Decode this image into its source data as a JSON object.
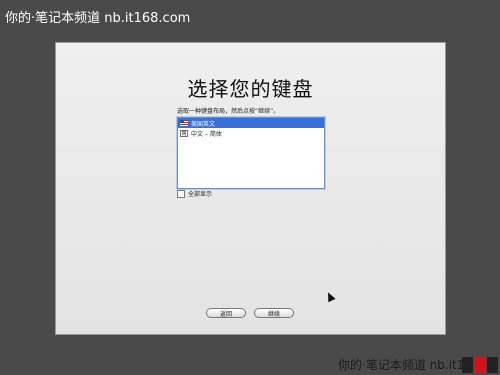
{
  "watermark": {
    "top": "你的·笔记本频道  nb.it168.com",
    "bottom": "你的·笔记本频道  nb.it1"
  },
  "installer": {
    "title": "选择您的键盘",
    "instruction": "选取一种键盘布局，然后点按“继续”。",
    "layouts": [
      {
        "label": "美国英文",
        "icon": "us-flag-icon",
        "selected": true
      },
      {
        "label": "中文 – 简体",
        "icon": "chinese-input-icon",
        "selected": false
      }
    ],
    "show_all_label": "全部显示",
    "buttons": {
      "back": "返回",
      "continue": "继续"
    }
  },
  "colors": {
    "background": "#4a4a4a",
    "selection": "#3a6fd8",
    "logo_red": "#d0141a"
  }
}
